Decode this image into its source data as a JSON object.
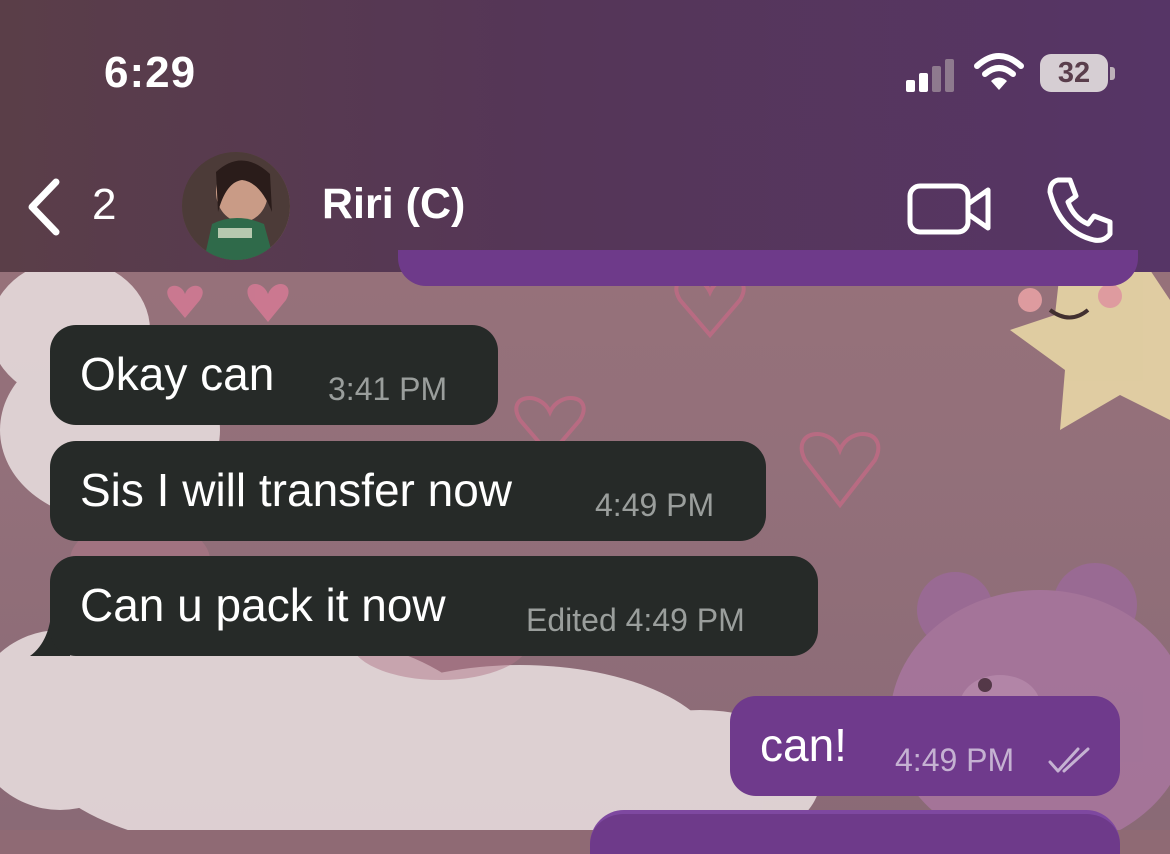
{
  "status_bar": {
    "time": "6:29",
    "battery": "32"
  },
  "header": {
    "back_count": "2",
    "contact_name": "Riri (C)"
  },
  "messages": [
    {
      "direction": "in",
      "text": "Okay can",
      "time": "3:41 PM",
      "edited": ""
    },
    {
      "direction": "in",
      "text": "Sis I will transfer now",
      "time": "4:49 PM",
      "edited": ""
    },
    {
      "direction": "in",
      "text": "Can u pack it now",
      "time": "4:49 PM",
      "edited": "Edited"
    },
    {
      "direction": "out",
      "text": "can!",
      "time": "4:49 PM",
      "status": "read"
    }
  ],
  "icons": [
    "back-chevron-icon",
    "video-call-icon",
    "phone-icon",
    "signal-icon",
    "wifi-icon",
    "battery-icon",
    "double-check-icon"
  ],
  "colors": {
    "incoming_bubble": "#262a28",
    "outgoing_bubble": "#6f3a8c",
    "header": "#553657"
  }
}
